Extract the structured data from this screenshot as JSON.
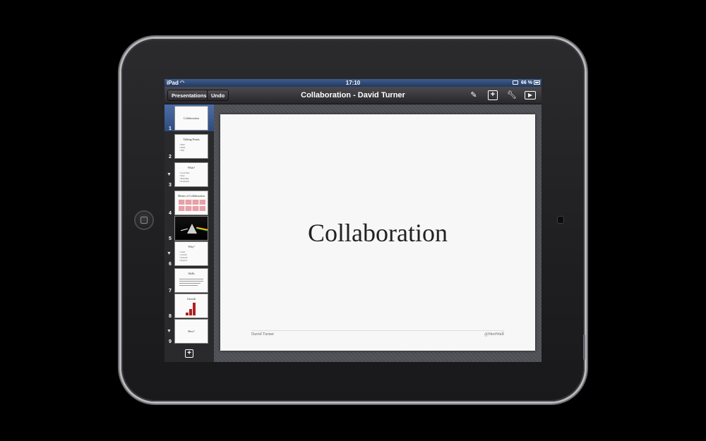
{
  "status_bar": {
    "carrier": "iPad",
    "time": "17:10",
    "battery": "66 %"
  },
  "toolbar": {
    "presentations_label": "Presentations",
    "undo_label": "Undo",
    "title": "Collaboration - David Turner",
    "icons": [
      "format-brush-icon",
      "add-slide-icon",
      "wrench-icon",
      "play-icon"
    ]
  },
  "navigator": {
    "slides": [
      {
        "num": "1",
        "title": "Collaboration",
        "selected": true
      },
      {
        "num": "2",
        "title": "Talking Points",
        "bullets": [
          "• What",
          "• When",
          "• Why"
        ]
      },
      {
        "num": "3",
        "title": "What?",
        "collapsed_arrow": true,
        "bullets": [
          "• Good ideas",
          "• Sales",
          "• Marketing",
          "• Production"
        ]
      },
      {
        "num": "4",
        "title": "Means of Collaboration"
      },
      {
        "num": "5",
        "title": ""
      },
      {
        "num": "6",
        "title": "Why?",
        "collapsed_arrow": true,
        "bullets": [
          "• Goals",
          "• Growth",
          "• Network",
          "• Projects"
        ]
      },
      {
        "num": "7",
        "title": "Skills"
      },
      {
        "num": "8",
        "title": "Growth"
      },
      {
        "num": "9",
        "title": "How?",
        "collapsed_arrow": true
      }
    ],
    "bar_values": [
      0.2,
      0.5,
      1.0
    ]
  },
  "slide": {
    "title": "Collaboration",
    "footer_left": "David Turner",
    "footer_right": "@HertWalf"
  },
  "colors": {
    "accent": "#3e5d8f",
    "chart_bar": "#b32020"
  }
}
